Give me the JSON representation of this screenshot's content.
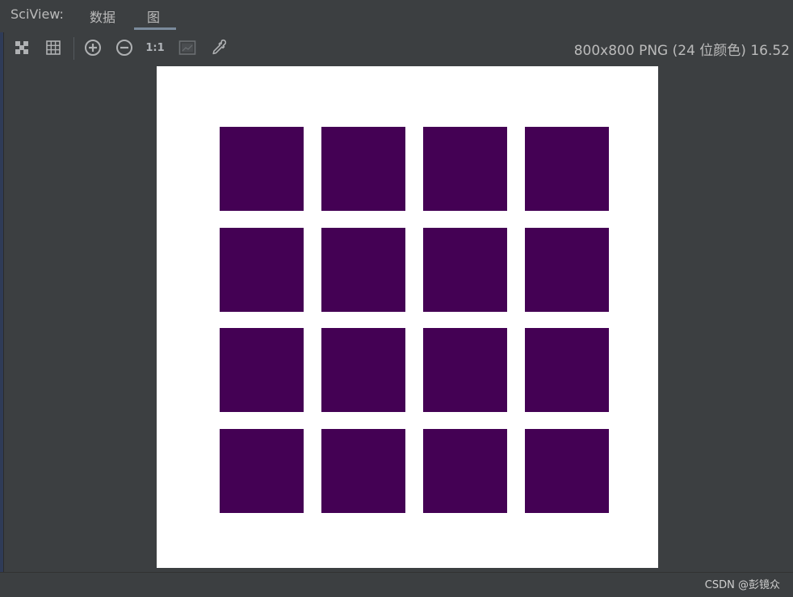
{
  "tool_window": {
    "title": "SciView:",
    "tabs": [
      {
        "label": "数据",
        "active": false
      },
      {
        "label": "图",
        "active": true
      }
    ]
  },
  "toolbar": {
    "buttons": [
      {
        "icon": "zoom-to-fit-icon"
      },
      {
        "icon": "grid-icon"
      },
      {
        "icon": "zoom-in-icon"
      },
      {
        "icon": "zoom-out-icon"
      },
      {
        "icon": "actual-size-icon",
        "label": "1:1"
      },
      {
        "icon": "background-icon"
      },
      {
        "icon": "color-picker-icon"
      }
    ],
    "image_info": "800x800 PNG (24 位颜色) 16.52"
  },
  "image": {
    "background": "#ffffff",
    "grid": {
      "rows": 4,
      "cols": 4,
      "fill": "#440154"
    }
  },
  "status_bar": {
    "watermark": "CSDN @彭镜众"
  }
}
